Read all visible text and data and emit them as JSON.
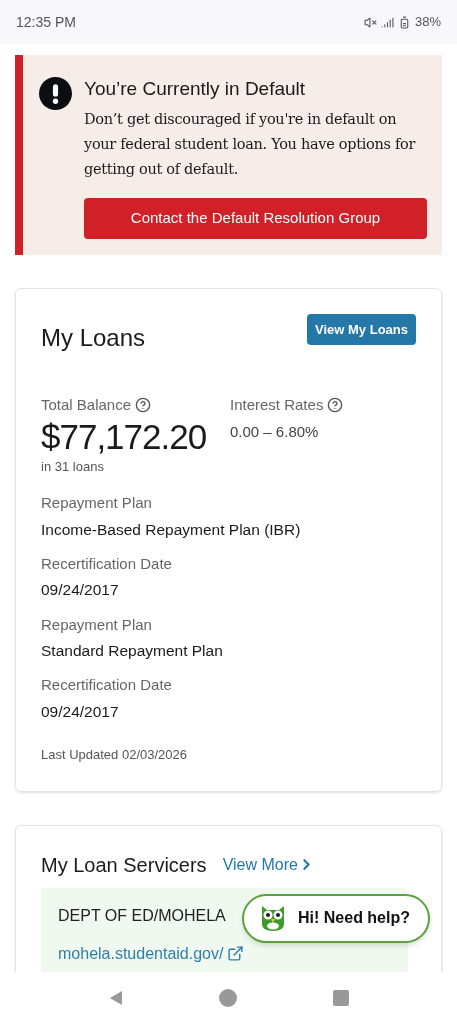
{
  "status_bar": {
    "time": "12:35 PM",
    "battery": "38%"
  },
  "alert": {
    "title": "You’re Currently in Default",
    "message": "Don’t get discouraged if you're in default on your federal student loan. You have options for getting out of default.",
    "button": "Contact the Default Resolution Group"
  },
  "loans_card": {
    "title": "My Loans",
    "button": "View My Loans",
    "total_balance_label": "Total Balance",
    "total_balance": "$77,172.20",
    "loan_count": "in 31 loans",
    "interest_label": "Interest Rates",
    "interest_value": "0.00 – 6.80%",
    "details": [
      {
        "label": "Repayment Plan",
        "value": "Income-Based Repayment Plan (IBR)"
      },
      {
        "label": "Recertification Date",
        "value": "09/24/2017"
      },
      {
        "label": "Repayment Plan",
        "value": "Standard Repayment Plan"
      },
      {
        "label": "Recertification Date",
        "value": "09/24/2017"
      }
    ],
    "last_updated": "Last Updated 02/03/2026"
  },
  "servicers_card": {
    "title": "My Loan Servicers",
    "link": "View More",
    "servicer": {
      "name": "DEPT OF ED/MOHELA",
      "url": "mohela.studentaid.gov/"
    }
  },
  "chat_button": "Hi! Need help?"
}
